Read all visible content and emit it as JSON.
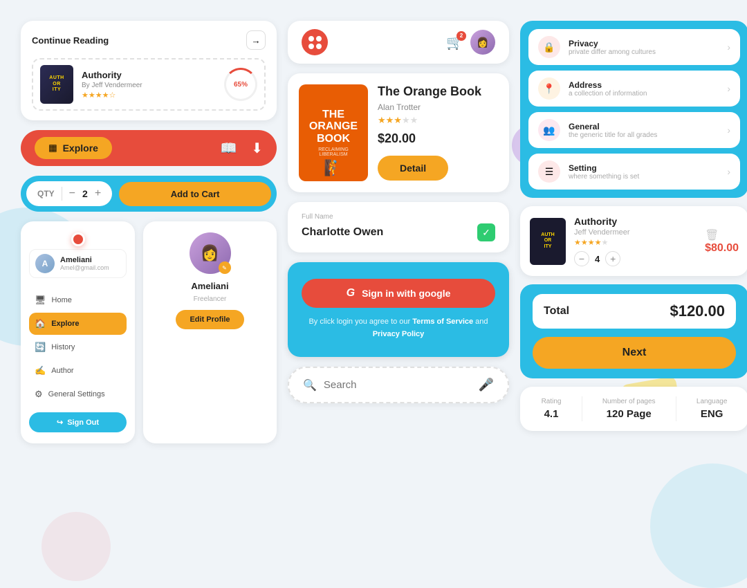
{
  "col1": {
    "continue_reading": {
      "title": "Continue Reading",
      "arrow": "→",
      "book": {
        "name": "Authority",
        "author": "By Jeff Vendermeer",
        "stars": "★★★★☆",
        "progress": "65%",
        "cover_line1": "AUTH",
        "cover_line2": "OR",
        "cover_line3": "ITY"
      }
    },
    "explore_bar": {
      "explore_label": "Explore",
      "book_icon": "📖",
      "download_icon": "⬇"
    },
    "qty_cart": {
      "qty_label": "QTY",
      "minus": "−",
      "qty_value": "2",
      "plus": "+",
      "add_to_cart": "Add to Cart"
    },
    "sidebar": {
      "username": "Ameliani",
      "email": "Amel@gmail.com",
      "menu_items": [
        {
          "label": "Home",
          "icon": "🖥",
          "active": false
        },
        {
          "label": "Explore",
          "icon": "🏠",
          "active": true
        },
        {
          "label": "History",
          "icon": "🔄",
          "active": false
        },
        {
          "label": "Author",
          "icon": "✍",
          "active": false
        },
        {
          "label": "General Settings",
          "icon": "⚙",
          "active": false
        }
      ],
      "sign_out": "Sign Out"
    },
    "profile": {
      "name": "Ameliani",
      "role": "Freelancer",
      "edit_btn": "Edit Profile"
    }
  },
  "col2": {
    "app_bar": {
      "cart_badge": "2"
    },
    "book_product": {
      "title": "The Orange Book",
      "cover_line1": "THE",
      "cover_line2": "ORANGE",
      "cover_line3": "BOOK",
      "cover_sub": "RECLAIMING LIBERALISM",
      "author": "Alan Trotter",
      "stars_filled": 3,
      "stars_total": 5,
      "price": "$20.00",
      "detail_btn": "Detail"
    },
    "name_input": {
      "label": "Full Name",
      "value": "Charlotte Owen"
    },
    "signin": {
      "btn_label": "Sign in with google",
      "terms_text": "By click login you agree to our ",
      "terms_link1": "Terms of Service",
      "terms_and": " and ",
      "terms_link2": "Privacy Policy"
    },
    "search": {
      "placeholder": "Search"
    }
  },
  "col3": {
    "settings": {
      "items": [
        {
          "name": "Privacy",
          "desc": "private differ among cultures",
          "icon": "🔒",
          "color": "red"
        },
        {
          "name": "Address",
          "desc": "a collection of information",
          "icon": "📍",
          "color": "orange"
        },
        {
          "name": "General",
          "desc": "the generic title for all grades",
          "icon": "👥",
          "color": "pink"
        },
        {
          "name": "Setting",
          "desc": "where something is set",
          "icon": "☰",
          "color": "coral"
        }
      ]
    },
    "cart_item": {
      "title": "Authority",
      "author": "Jeff Vendermeer",
      "stars_filled": 4,
      "stars_total": 5,
      "qty": "4",
      "price": "$80.00",
      "cover_line1": "AUTH",
      "cover_line2": "OR",
      "cover_line3": "ITY"
    },
    "total": {
      "label": "Total",
      "amount": "$120.00",
      "next_btn": "Next"
    },
    "book_stats": {
      "rating_label": "Rating",
      "rating_value": "4.1",
      "pages_label": "Number of pages",
      "pages_value": "120 Page",
      "lang_label": "Language",
      "lang_value": "ENG"
    }
  }
}
